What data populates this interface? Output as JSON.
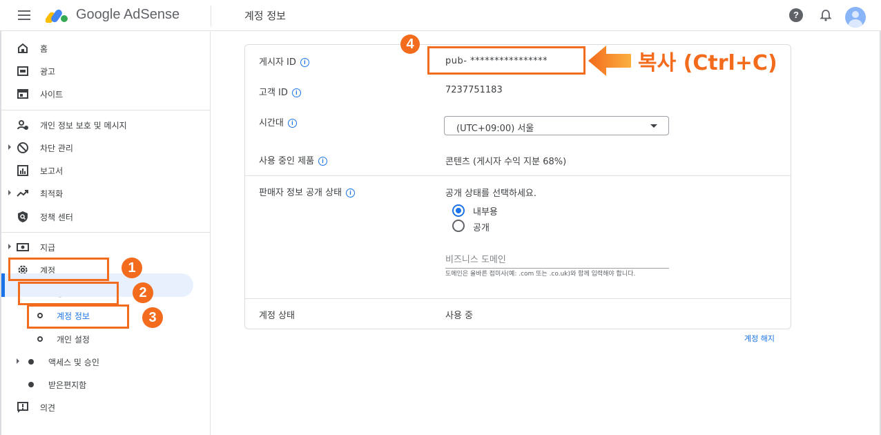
{
  "app": {
    "logo_text": "Google AdSense",
    "page_title": "계정 정보",
    "help_glyph": "?"
  },
  "sidebar": {
    "items": [
      {
        "label": "홈",
        "icon": "home-icon"
      },
      {
        "label": "광고",
        "icon": "ads-icon"
      },
      {
        "label": "사이트",
        "icon": "sites-icon"
      },
      {
        "label": "개인 정보 보호 및 메시지",
        "icon": "privacy-icon"
      },
      {
        "label": "차단 관리",
        "icon": "block-icon"
      },
      {
        "label": "보고서",
        "icon": "reports-icon"
      },
      {
        "label": "최적화",
        "icon": "optimization-icon"
      },
      {
        "label": "정책 센터",
        "icon": "policy-icon"
      },
      {
        "label": "지급",
        "icon": "payments-icon"
      },
      {
        "label": "계정",
        "icon": "gear-icon"
      },
      {
        "label": "설정",
        "icon": "dot"
      },
      {
        "label": "계정 정보",
        "icon": "ring"
      },
      {
        "label": "개인 설정",
        "icon": "ring"
      },
      {
        "label": "액세스 및 승인",
        "icon": "dot"
      },
      {
        "label": "받은편지함",
        "icon": "dot"
      },
      {
        "label": "의견",
        "icon": "feedback-icon"
      }
    ]
  },
  "annotations": {
    "step1": "1",
    "step2": "2",
    "step3": "3",
    "step4": "4",
    "callout": "복사 (Ctrl+C)",
    "color": "#f36b1c"
  },
  "account": {
    "publisher_id_label": "게시자 ID",
    "publisher_id_value": "pub- ****************",
    "customer_id_label": "고객 ID",
    "customer_id_value": "7237751183",
    "timezone_label": "시간대",
    "timezone_value": "(UTC+09:00) 서울",
    "products_label": "사용 중인 제품",
    "products_value": "콘텐츠 (게시자 수익 지분 68%)",
    "seller_label": "판매자 정보 공개 상태",
    "seller_prompt": "공개 상태를 선택하세요.",
    "radio_internal": "내부용",
    "radio_public": "공개",
    "domain_placeholder": "비즈니스 도메인",
    "domain_hint": "도메인은 올바른 접미사(예: .com 또는 .co.uk)와 함께 입력해야 합니다.",
    "status_label": "계정 상태",
    "status_value": "사용 중",
    "close_account": "계정 해지",
    "info_glyph": "i"
  },
  "colors": {
    "accent": "#1a73e8",
    "annotation": "#f36b1c"
  }
}
